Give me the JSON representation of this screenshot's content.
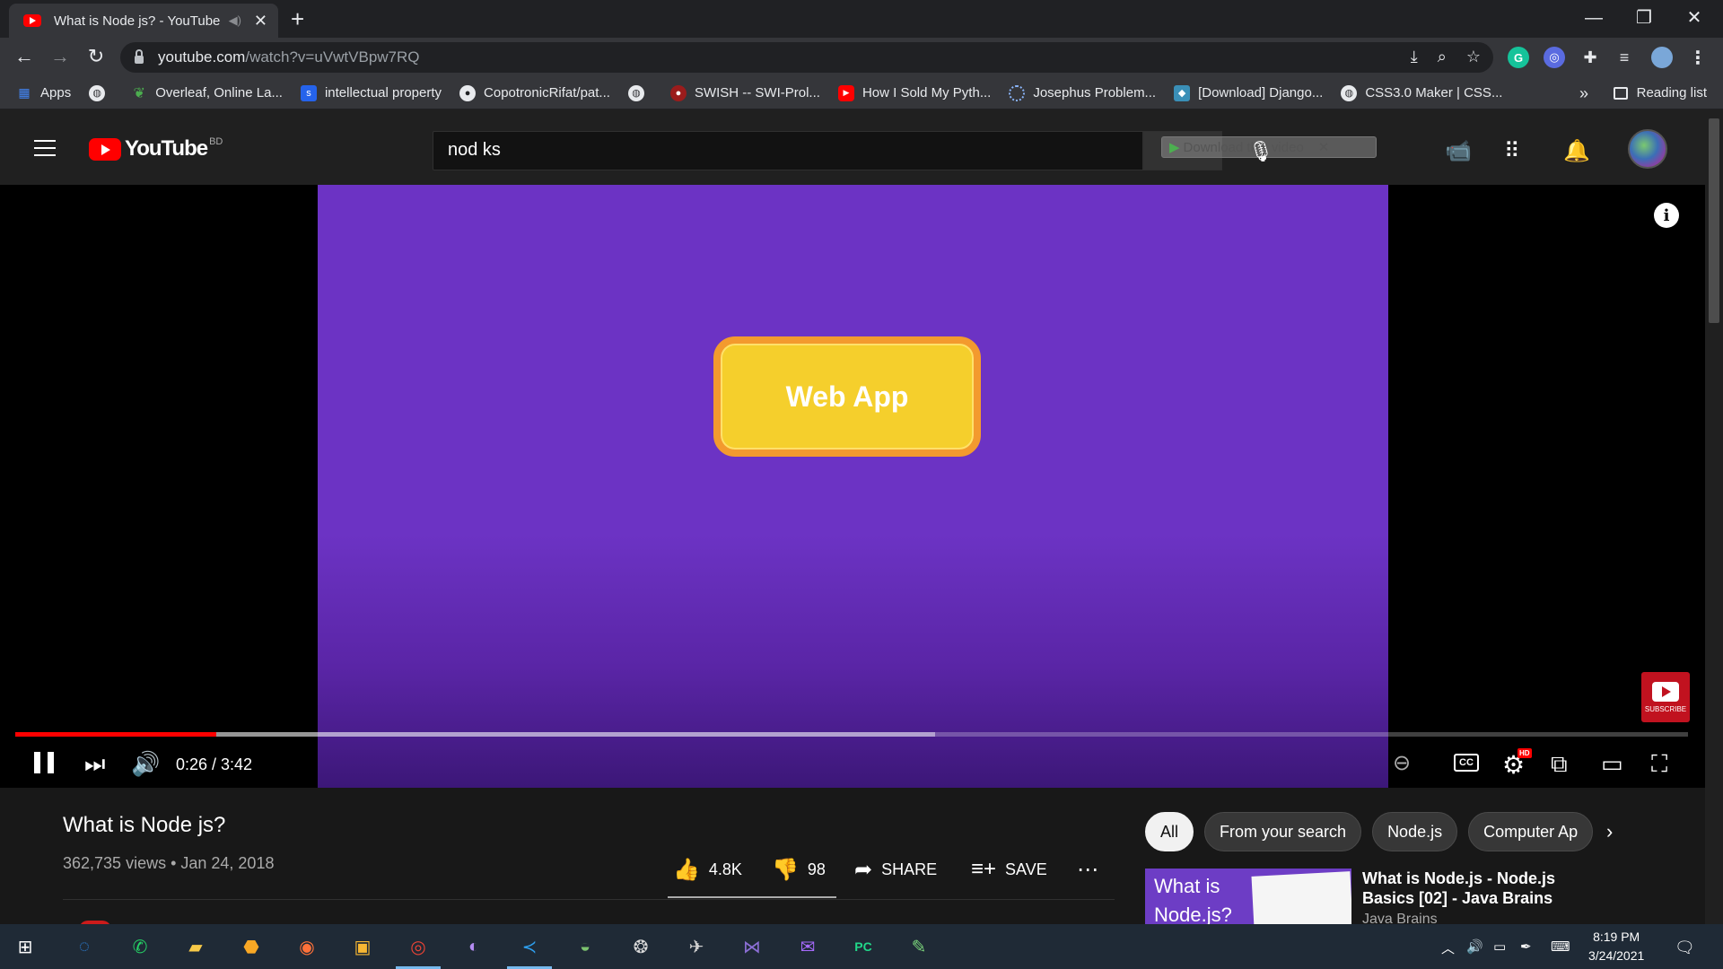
{
  "browser": {
    "tab_title": "What is Node js? - YouTube",
    "url_host": "youtube.com",
    "url_path": "/watch?v=uVwtVBpw7RQ",
    "bookmarks": [
      "Apps",
      "",
      "Overleaf, Online La...",
      "intellectual property",
      "CopotronicRifat/pat...",
      "",
      "SWISH -- SWI-Prol...",
      "How I Sold My Pyth...",
      "Josephus Problem...",
      "[Download] Django...",
      "CSS3.0 Maker | CSS..."
    ],
    "more_bookmarks": "»",
    "reading_list": "Reading list"
  },
  "youtube": {
    "logo_text": "YouTube",
    "country": "BD",
    "search_value": "nod ks",
    "download_overlay": "Download this video"
  },
  "player": {
    "slide_text": "Web App",
    "current_time": "0:26",
    "duration": "3:42",
    "time_display": "0:26 / 3:42",
    "played_fraction": 0.12,
    "buffered_fraction": 0.55,
    "cc_label": "CC",
    "hd_badge": "HD",
    "subscribe_watermark": "SUBSCRIBE",
    "info_icon": "i"
  },
  "video": {
    "title": "What is Node js?",
    "meta": "362,735 views • Jan 24, 2018",
    "likes": "4.8K",
    "dislikes": "98",
    "share": "SHARE",
    "save": "SAVE"
  },
  "sidebar": {
    "chips": [
      "All",
      "From your search",
      "Node.js",
      "Computer Ap"
    ],
    "recommendation": {
      "thumb_text_1": "What is",
      "thumb_text_2": "Node.js?",
      "title": "What is Node.js - Node.js Basics [02] - Java Brains",
      "channel": "Java Brains"
    }
  },
  "taskbar": {
    "time": "8:19 PM",
    "date": "3/24/2021"
  }
}
